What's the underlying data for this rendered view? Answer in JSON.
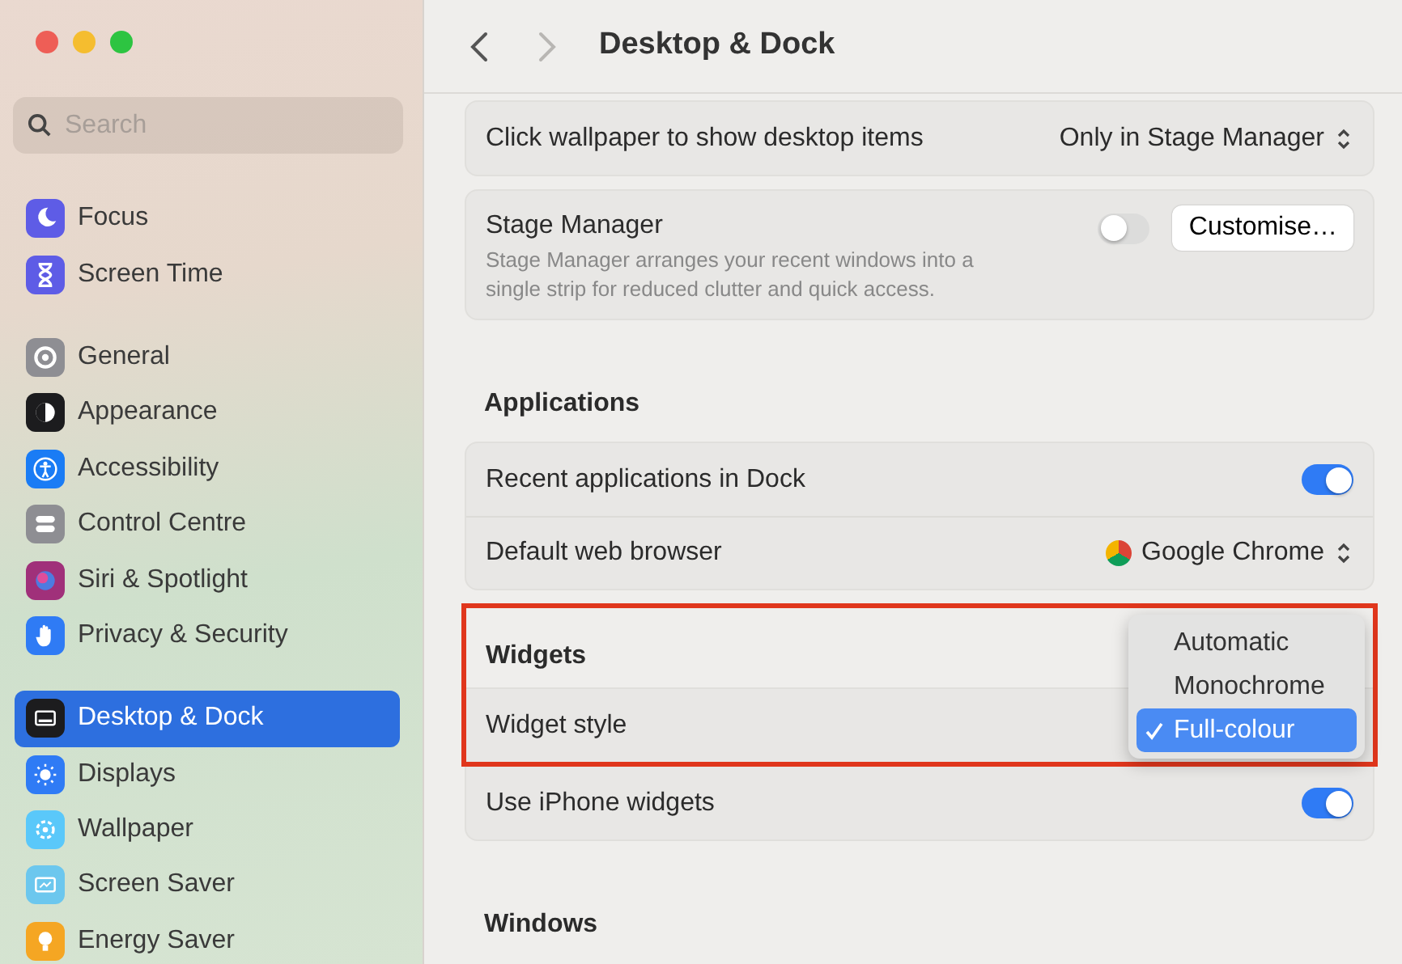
{
  "window": {
    "title": "Desktop & Dock",
    "back": {
      "disabled": false
    },
    "forward": {
      "disabled": true
    }
  },
  "sidebar": {
    "search": {
      "placeholder": "Search"
    },
    "groups": [
      [
        {
          "label": "Focus",
          "kind": "moon",
          "color": "#5e5ce6",
          "selected": false
        },
        {
          "label": "Screen Time",
          "kind": "hourglass",
          "color": "#5e5ce6",
          "selected": false
        }
      ],
      [
        {
          "label": "General",
          "kind": "gear",
          "color": "#8e8e93",
          "selected": false
        },
        {
          "label": "Appearance",
          "kind": "contrast",
          "color": "#1c1c1e",
          "selected": false
        },
        {
          "label": "Accessibility",
          "kind": "person",
          "color": "#1a7cf5",
          "selected": false
        },
        {
          "label": "Control Centre",
          "kind": "switches",
          "color": "#8e8e93",
          "selected": false
        },
        {
          "label": "Siri & Spotlight",
          "kind": "orb",
          "color": "#a0307a",
          "selected": false
        },
        {
          "label": "Privacy & Security",
          "kind": "hand",
          "color": "#2f7bf5",
          "selected": false
        }
      ],
      [
        {
          "label": "Desktop & Dock",
          "kind": "dock",
          "color": "#1c1c1e",
          "selected": true
        },
        {
          "label": "Displays",
          "kind": "sun",
          "color": "#2f7bf5",
          "selected": false
        },
        {
          "label": "Wallpaper",
          "kind": "flower",
          "color": "#5ac8fa",
          "selected": false
        },
        {
          "label": "Screen Saver",
          "kind": "screen",
          "color": "#6cc7ee",
          "selected": false
        },
        {
          "label": "Energy Saver",
          "kind": "bulb",
          "color": "#f5a623",
          "selected": false
        }
      ]
    ]
  },
  "sections": [
    {
      "cards": [
        {
          "rows": [
            {
              "kind": "select",
              "label": "Click wallpaper to show desktop items",
              "value": "Only in Stage Manager"
            }
          ]
        },
        {
          "rows": [
            {
              "kind": "toggle-button",
              "label": "Stage Manager",
              "description": "Stage Manager arranges your recent windows into a single strip for reduced clutter and quick access.",
              "on": false,
              "button": "Customise…"
            }
          ]
        }
      ]
    },
    {
      "heading": "Applications",
      "cards": [
        {
          "rows": [
            {
              "kind": "toggle",
              "label": "Recent applications in Dock",
              "on": true
            },
            {
              "kind": "browser-select",
              "label": "Default web browser",
              "value": "Google Chrome"
            }
          ]
        }
      ]
    },
    {
      "heading": "Widgets",
      "highlighted": true,
      "cards": [
        {
          "rows": [
            {
              "kind": "menu",
              "label": "Widget style",
              "highlighted": true,
              "options": [
                {
                  "label": "Automatic",
                  "selected": false
                },
                {
                  "label": "Monochrome",
                  "selected": false
                },
                {
                  "label": "Full-colour",
                  "selected": true
                }
              ]
            },
            {
              "kind": "toggle",
              "label": "Use iPhone widgets",
              "on": true
            }
          ]
        }
      ]
    },
    {
      "heading": "Windows"
    }
  ]
}
